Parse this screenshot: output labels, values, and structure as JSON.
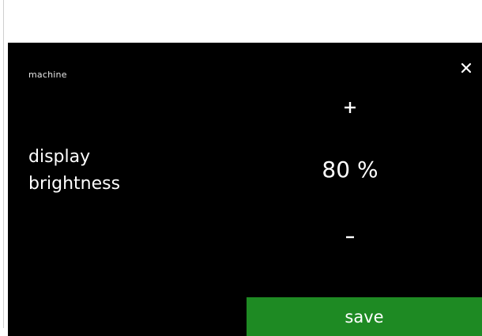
{
  "header": {
    "title": "machine",
    "close_icon": "close-icon"
  },
  "setting": {
    "label_line1": "display",
    "label_line2": "brightness",
    "value": "80 %",
    "increment_label": "+",
    "decrement_label": "–"
  },
  "footer": {
    "save_label": "save"
  },
  "colors": {
    "screen_background": "#000000",
    "text": "#ffffff",
    "save_button": "#1e8a23"
  }
}
